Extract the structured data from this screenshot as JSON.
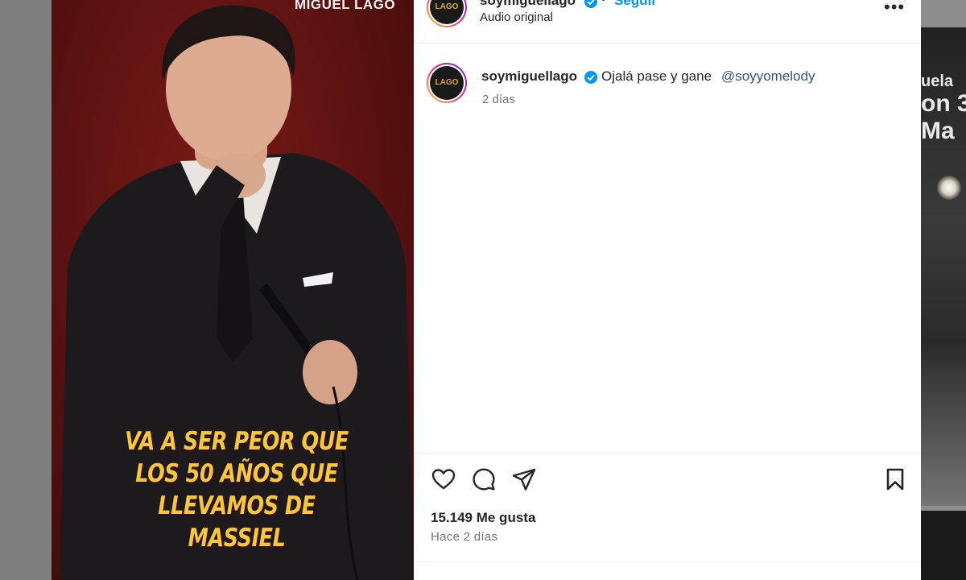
{
  "media": {
    "watermark": "MIGUEL LAGO",
    "caption": [
      "VA A SER PEOR QUE",
      "LOS 50 AÑOS QUE",
      "LLEVAMOS DE MASSIEL"
    ]
  },
  "header": {
    "username": "soymiguellago",
    "separator": "•",
    "follow_label": "Seguir",
    "audio": "Audio original",
    "more_label": "•••",
    "avatar_text": "LAGO"
  },
  "comment": {
    "username": "soymiguellago",
    "text": "Ojalá pase y gane",
    "mention": "@soyyomelody",
    "time": "2 días"
  },
  "actions": {
    "icons": [
      "heart-icon",
      "comment-icon",
      "share-icon",
      "bookmark-icon"
    ],
    "likes": "15.149 Me gusta",
    "date": "Hace 2 días"
  },
  "background": {
    "right_text": [
      "uela",
      "on 3",
      "Ma"
    ]
  },
  "colors": {
    "follow": "#0095f6",
    "mention": "#385185",
    "verified": "#0095f6",
    "caption": "#f5c93a",
    "media_bg": "#5a1210"
  }
}
